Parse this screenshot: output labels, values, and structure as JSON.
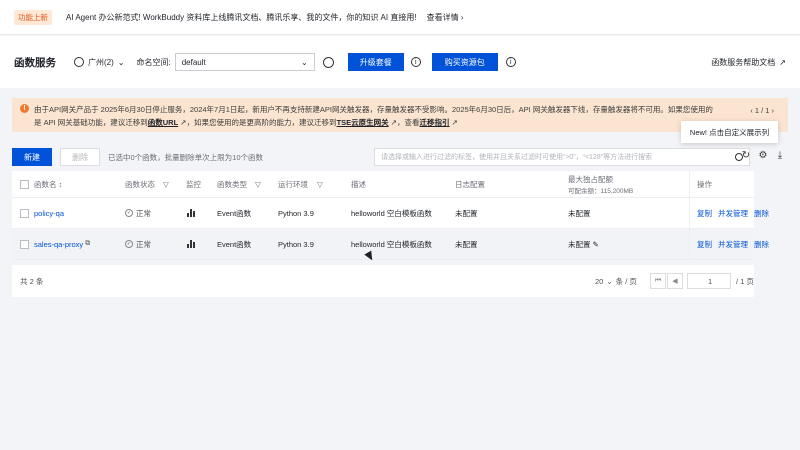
{
  "topbar": {
    "badge": "功能上新",
    "promo": "AI Agent 办公新范式! WorkBuddy 资料库上线腾讯文档、腾讯乐享、我的文件，你的知识 AI 直接用!",
    "link": "查看详情 ›"
  },
  "header": {
    "title": "函数服务",
    "region": "广州(2)",
    "namespace_label": "命名空间:",
    "namespace_value": "default",
    "upgrade_button": "升级套餐",
    "buy_button": "购买资源包",
    "doc_link": "函数服务帮助文档"
  },
  "notice": {
    "part1": "由于API网关产品于 2025年6月30日停止服务，2024年7月1日起，新用户不再支持新建API网关触发器，存量触发器不受影响。2025年6月30日后，API 网关触发器下线，存量触发器将不可用。如果您使用的",
    "part2": "是 API 网关基础功能，建议迁移到",
    "link1": "函数URL",
    "part3": "，如果您使用的是更高阶的能力，建议迁移到",
    "link2": "TSE云原生网关",
    "part4": "，查看",
    "link3": "迁移指引",
    "pager": "‹ 1 / 1 ›"
  },
  "tooltip": "New! 点击自定义展示列",
  "toolbar": {
    "new_button": "新建",
    "delete_button": "删除",
    "selection_hint": "已选中0个函数，批量删除单次上限为10个函数",
    "search_placeholder": "请选择或输入进行过滤的标签，使用并且关系过滤时可使用“>0”，“<128”等方法进行搜索"
  },
  "table": {
    "headers": {
      "name": "函数名 ↕",
      "status": "函数状态",
      "monitor": "监控",
      "type": "函数类型",
      "runtime": "运行环境",
      "desc": "描述",
      "log": "日志配置",
      "max_conc": "最大独占配额",
      "quota": "可配余额：115,200MB",
      "ops": "操作"
    },
    "rows": [
      {
        "name": "policy-qa",
        "status": "正常",
        "type": "Event函数",
        "runtime": "Python 3.9",
        "desc": "helloworld 空白模板函数",
        "log": "未配置",
        "max_conc": "未配置",
        "op1": "复制",
        "op2": "并发管理",
        "op3": "删除"
      },
      {
        "name": "sales-qa-proxy",
        "status": "正常",
        "type": "Event函数",
        "runtime": "Python 3.9",
        "desc": "helloworld 空白模板函数",
        "log": "未配置",
        "max_conc": "未配置",
        "op1": "复制",
        "op2": "并发管理",
        "op3": "删除"
      }
    ]
  },
  "footer": {
    "total": "共 2 条",
    "page_size": "20",
    "page_size_unit": "条 / 页",
    "page_current": "1",
    "page_total": "/ 1 页"
  }
}
